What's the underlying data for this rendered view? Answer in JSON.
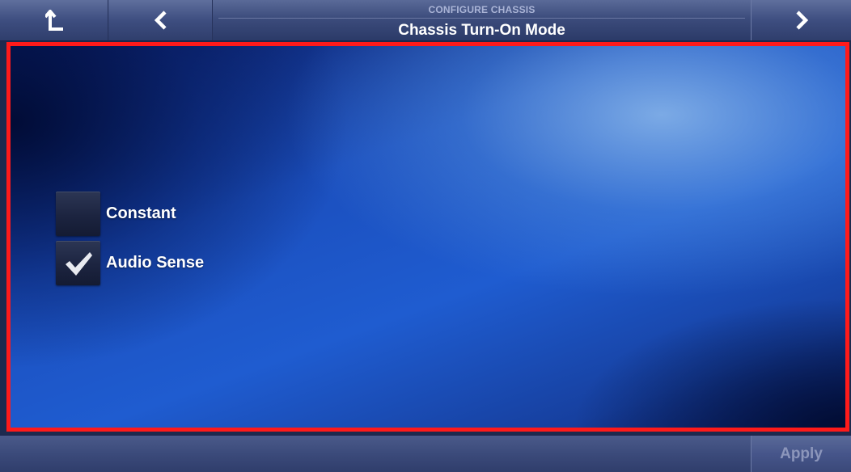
{
  "header": {
    "subtitle": "CONFIGURE CHASSIS",
    "title": "Chassis Turn-On Mode"
  },
  "nav": {
    "up_icon": "up-level-arrow-icon",
    "back_icon": "chevron-left-icon",
    "next_icon": "chevron-right-icon"
  },
  "options": [
    {
      "label": "Constant",
      "checked": false
    },
    {
      "label": "Audio Sense",
      "checked": true
    }
  ],
  "footer": {
    "apply_label": "Apply",
    "apply_enabled": false
  },
  "colors": {
    "highlight_border": "#ff1a1a",
    "panel_blue": "#1f5cd0",
    "bar_blue": "#3c4c7c",
    "checkmark": "#e8eaf0",
    "disabled_text": "#8c96bb"
  }
}
